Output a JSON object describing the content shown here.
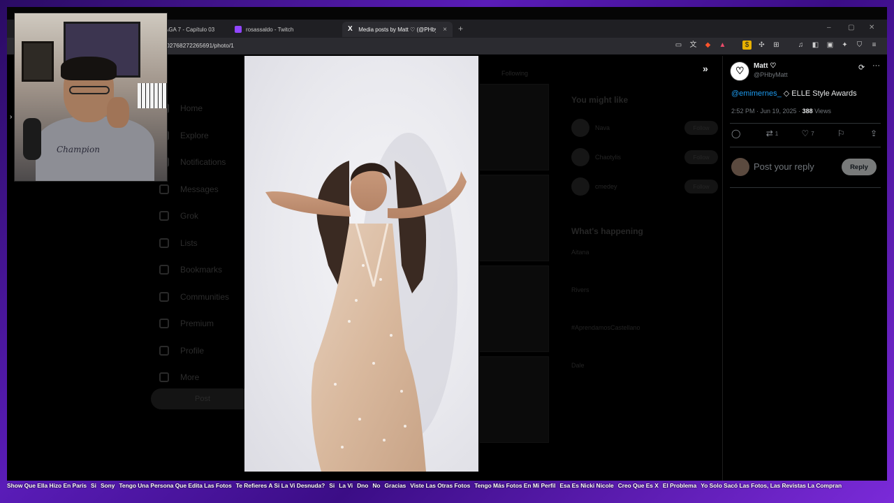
{
  "browser": {
    "tabs": [
      {
        "label": "AGA 7 - Capítulo 03",
        "favicon_color": "#e33b3b"
      },
      {
        "label": "rosassaldo - Twitch",
        "favicon_color": "#9146ff"
      },
      {
        "label": "Media posts by Matt ♡ (@PHbyM",
        "favicon_color": "#ffffff",
        "active": true
      }
    ],
    "new_tab_symbol": "+",
    "url": "027682722656​91/photo/1",
    "window_controls": [
      "–",
      "▢",
      "✕"
    ]
  },
  "background_page": {
    "nav_items": [
      "Home",
      "Explore",
      "Notifications",
      "Messages",
      "Grok",
      "Lists",
      "Bookmarks",
      "Communities",
      "Premium",
      "Profile",
      "More"
    ],
    "post_button": "Post",
    "tab_label": "Following",
    "you_might_like": "You might like",
    "suggestions": [
      {
        "name": "Nava",
        "follow": "Follow"
      },
      {
        "name": "Chaotylis",
        "follow": "Follow"
      },
      {
        "name": "cmedey",
        "follow": "Follow"
      }
    ],
    "whats_happening": "What's happening",
    "trends": [
      "Aitana",
      "Rivers",
      "#AprendamosCastellano",
      "Dale"
    ]
  },
  "photo": {
    "alt_label": "Photo"
  },
  "tweet": {
    "author_name": "Matt ♡",
    "author_handle": "@PHbyMatt",
    "mention": "@emimernes_",
    "text": " ◇ ELLE Style Awards",
    "time": "2:52 PM · Jun 19, 2025 · ",
    "views_count": "388",
    "views_label": " Views",
    "reply_count": "",
    "retweet_count": "1",
    "like_count": "7",
    "reply_placeholder": "Post your reply",
    "reply_button": "Reply"
  },
  "ticker": [
    "Show Que Ella Hizo En París",
    "Si",
    "Sony",
    "Tengo Una Persona Que Edita Las Fotos",
    "Te Refieres A Si La Vi Desnuda?",
    "Si",
    "La Vi",
    "Dno",
    "No",
    "Gracias",
    "Viste Las Otras Fotos",
    "Tengo Más Fotos En Mi Perfil",
    "Esa Es Nicki Nicole",
    "Creo Que Es X",
    "El Problema",
    "Yo Solo Sacó Las Fotos, Las Revistas La Compran"
  ],
  "webcam": {
    "shirt_logo": "Champion"
  }
}
